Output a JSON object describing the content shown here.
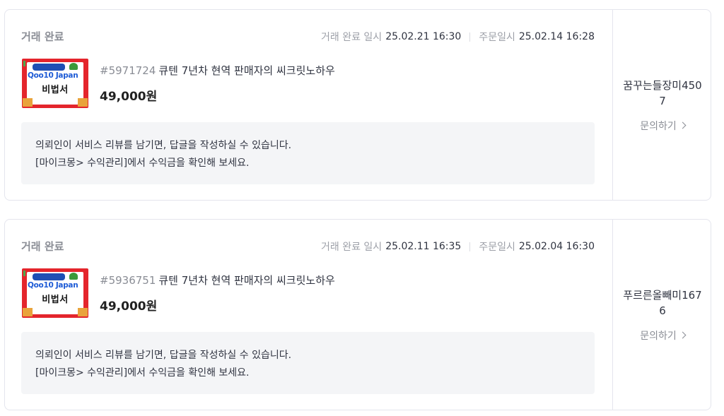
{
  "orders": [
    {
      "status": "거래 완료",
      "completed_label": "거래 완료 일시",
      "completed_at": "25.02.21 16:30",
      "ordered_label": "주문일시",
      "ordered_at": "25.02.14 16:28",
      "order_number": "#5971724",
      "title": "큐텐 7년차 현역 판매자의 씨크릿노하우",
      "price": "49,000원",
      "thumb": {
        "brand": "Qoo10 Japan",
        "title": "비법서"
      },
      "notice_line1": "의뢰인이 서비스 리뷰를 남기면, 답글을 작성하실 수 있습니다.",
      "notice_line2": "[마이크몽> 수익관리]에서 수익금을 확인해 보세요.",
      "seller": "꿈꾸는들장미4507",
      "inquiry_label": "문의하기"
    },
    {
      "status": "거래 완료",
      "completed_label": "거래 완료 일시",
      "completed_at": "25.02.11 16:35",
      "ordered_label": "주문일시",
      "ordered_at": "25.02.04 16:30",
      "order_number": "#5936751",
      "title": "큐텐 7년차 현역 판매자의 씨크릿노하우",
      "price": "49,000원",
      "thumb": {
        "brand": "Qoo10 Japan",
        "title": "비법서"
      },
      "notice_line1": "의뢰인이 서비스 리뷰를 남기면, 답글을 작성하실 수 있습니다.",
      "notice_line2": "[마이크몽> 수익관리]에서 수익금을 확인해 보세요.",
      "seller": "푸르른올빼미1676",
      "inquiry_label": "문의하기"
    }
  ],
  "colors": {
    "accent_red": "#e4252c",
    "brand_blue": "#1d5bd6",
    "muted": "#8a8d95",
    "notice_bg": "#f4f5f7"
  }
}
